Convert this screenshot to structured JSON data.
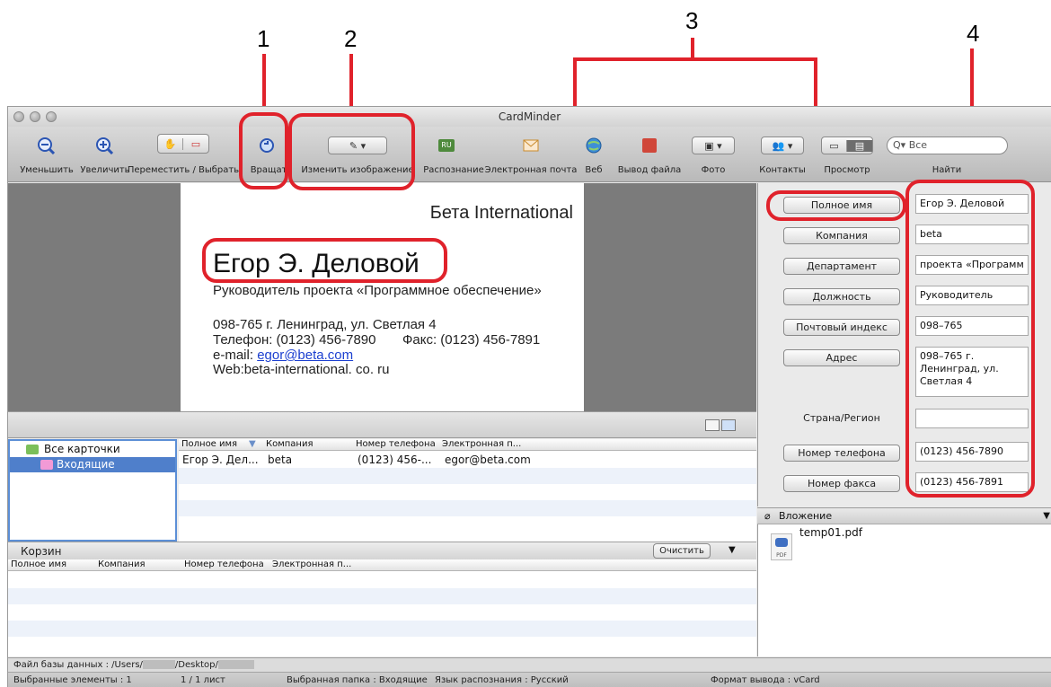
{
  "callouts": {
    "c1": "1",
    "c2": "2",
    "c3": "3",
    "c4": "4"
  },
  "window": {
    "title": "CardMinder"
  },
  "toolbar": {
    "zoom_out": "Уменьшить",
    "zoom_in": "Увеличить",
    "move_select": "Переместить / Выбрать",
    "rotate": "Вращать",
    "edit_image": "Изменить изображение",
    "recognize": "Распознание",
    "email": "Электронная почта",
    "web": "Веб",
    "file_output": "Вывод файла",
    "photo": "Фото",
    "contacts": "Контакты",
    "view": "Просмотр",
    "find": "Найти",
    "search_placeholder": "Все",
    "recognize_badge": "RU"
  },
  "card": {
    "company": "Бета International",
    "name": "Егор Э. Деловой",
    "title_line": "Руководитель проекта «Программное обеспечение»",
    "address_line": "098-765 г. Ленинград, ул. Светлая 4",
    "phone_line": "Телефон: (0123) 456-7890",
    "fax_line": "Факс: (0123) 456-7891",
    "email_prefix": "e-mail: ",
    "email_link": "egor@beta.com",
    "web_line": "Web:beta-international. co. ru"
  },
  "tree": {
    "all_cards": "Все карточки",
    "inbox": "Входящие"
  },
  "list": {
    "columns": [
      "Полное имя",
      "Компания",
      "Номер телефона",
      "Электронная п..."
    ],
    "rows": [
      {
        "name": "Егор Э. Дел...",
        "company": "beta",
        "phone": "(0123) 456-...",
        "email": "egor@beta.com"
      }
    ]
  },
  "trash": {
    "title": "Корзин",
    "clear": "Очистить",
    "columns": [
      "Полное имя",
      "Компания",
      "Номер телефона",
      "Электронная п..."
    ]
  },
  "fields": {
    "full_name": {
      "label": "Полное имя",
      "value": "Егор Э. Деловой"
    },
    "company": {
      "label": "Компания",
      "value": "beta"
    },
    "department": {
      "label": "Департамент",
      "value": "проекта «Программ"
    },
    "position": {
      "label": "Должность",
      "value": "Руководитель"
    },
    "postal": {
      "label": "Почтовый индекс",
      "value": "098–765"
    },
    "address": {
      "label": "Адрес",
      "value": "098–765 г. Ленинград, ул. Светлая 4"
    },
    "country": {
      "label": "Страна/Регион",
      "value": ""
    },
    "phone": {
      "label": "Номер телефона",
      "value": "(0123) 456-7890"
    },
    "fax": {
      "label": "Номер факса",
      "value": "(0123) 456-7891"
    }
  },
  "attachment": {
    "title": "Вложение",
    "file": "temp01.pdf",
    "badge": "PDF"
  },
  "status": {
    "db_prefix": "Файл базы данных : /Users/",
    "db_mid": "/Desktop/",
    "selected": "Выбранные элементы : 1",
    "pages": "1 / 1 лист",
    "folder": "Выбранная папка : Входящие",
    "language": "Язык распознания : Русский",
    "format": "Формат вывода : vCard"
  },
  "colors": {
    "callout_red": "#e0222b",
    "selection_blue": "#4f7fcb"
  }
}
